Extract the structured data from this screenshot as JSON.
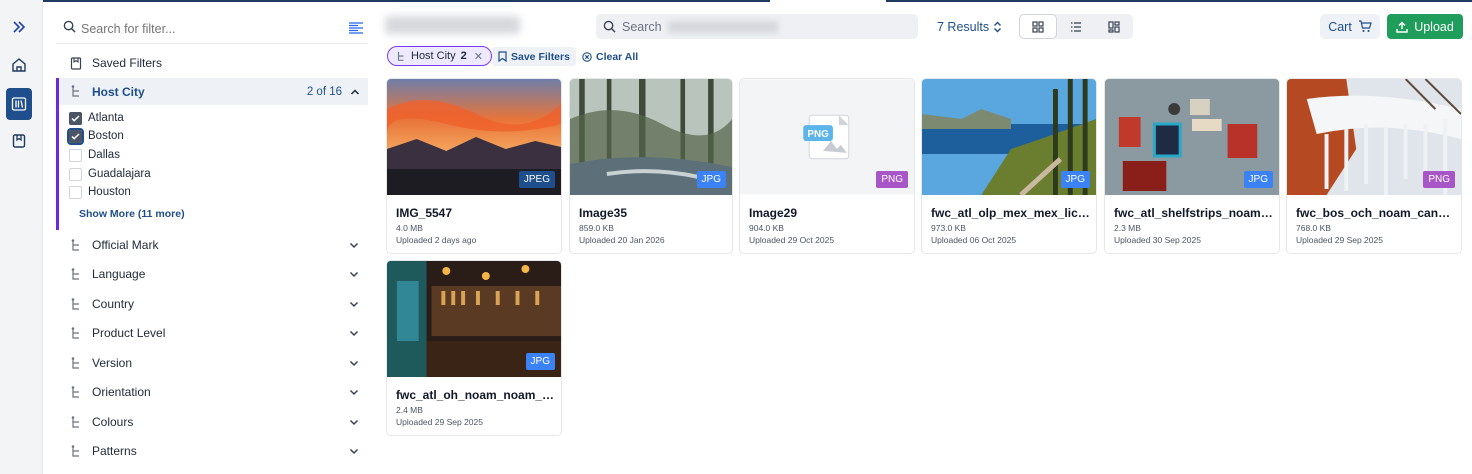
{
  "sidebar_filters": {
    "search_placeholder": "Search for filter...",
    "saved_filters_label": "Saved Filters",
    "host_city": {
      "label": "Host City",
      "count": "2 of 16",
      "options": [
        {
          "label": "Atlanta",
          "checked": true
        },
        {
          "label": "Boston",
          "checked": true
        },
        {
          "label": "Dallas",
          "checked": false
        },
        {
          "label": "Guadalajara",
          "checked": false
        },
        {
          "label": "Houston",
          "checked": false
        }
      ],
      "show_more": "Show More (11 more)"
    },
    "groups": [
      "Official Mark",
      "Language",
      "Country",
      "Product Level",
      "Version",
      "Orientation",
      "Colours",
      "Patterns"
    ]
  },
  "header": {
    "search_placeholder": "Search",
    "results": "7 Results",
    "cart_label": "Cart",
    "upload_label": "Upload"
  },
  "active_filters": {
    "chip_label": "Host City",
    "chip_count": "2",
    "save_filters": "Save Filters",
    "clear_all": "Clear All"
  },
  "assets": [
    {
      "name": "IMG_5547",
      "size": "4.0 MB",
      "uploaded": "Uploaded 2 days ago",
      "type": "JPEG",
      "badge_color": "#1e4e8c"
    },
    {
      "name": "Image35",
      "size": "859.0 KB",
      "uploaded": "Uploaded 20 Jan 2026",
      "type": "JPG",
      "badge_color": "#3b82f6"
    },
    {
      "name": "Image29",
      "size": "904.0 KB",
      "uploaded": "Uploaded 29 Oct 2025",
      "type": "PNG",
      "badge_color": "#a855c7",
      "placeholder_label": "PNG"
    },
    {
      "name": "fwc_atl_olp_mex_mex_licpr...",
      "size": "973.0 KB",
      "uploaded": "Uploaded 06 Oct 2025",
      "type": "JPG",
      "badge_color": "#3b82f6"
    },
    {
      "name": "fwc_atl_shelfstrips_noam_...",
      "size": "2.3 MB",
      "uploaded": "Uploaded 30 Sep 2025",
      "type": "JPG",
      "badge_color": "#3b82f6"
    },
    {
      "name": "fwc_bos_och_noam_can_li...",
      "size": "768.0 KB",
      "uploaded": "Uploaded 29 Sep 2025",
      "type": "PNG",
      "badge_color": "#a855c7"
    },
    {
      "name": "fwc_atl_oh_noam_noam_li...",
      "size": "2.4 MB",
      "uploaded": "Uploaded 29 Sep 2025",
      "type": "JPG",
      "badge_color": "#3b82f6"
    }
  ]
}
